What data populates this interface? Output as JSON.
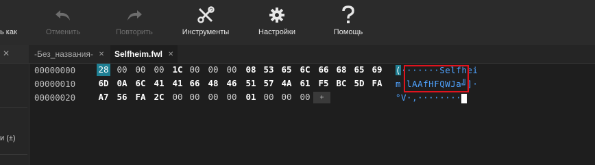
{
  "toolbar": {
    "save_as_partial": "ь как",
    "undo_label": "Отменить",
    "redo_label": "Повторить",
    "tools_label": "Инструменты",
    "settings_label": "Настройки",
    "help_label": "Помощь"
  },
  "tabs": [
    {
      "label": "-Без_названия-",
      "close": "✕"
    },
    {
      "label": "Selfheim.fwl",
      "close": "✕"
    }
  ],
  "sidebar": {
    "label_partial": "и (±)"
  },
  "hex": {
    "offsets": [
      "00000000",
      "00000010",
      "00000020"
    ],
    "rows": [
      [
        "28",
        "00",
        "00",
        "00",
        "1C",
        "00",
        "00",
        "00",
        "08",
        "53",
        "65",
        "6C",
        "66",
        "68",
        "65",
        "69"
      ],
      [
        "6D",
        "0A",
        "6C",
        "41",
        "41",
        "66",
        "48",
        "46",
        "51",
        "57",
        "4A",
        "61",
        "F5",
        "BC",
        "5D",
        "FA"
      ],
      [
        "A7",
        "56",
        "FA",
        "2C",
        "00",
        "00",
        "00",
        "00",
        "01",
        "00",
        "00",
        "00"
      ]
    ],
    "add_button": "+",
    "ascii": {
      "row0_first": "(",
      "row0_rest": "·······Selfhei",
      "row1": "m lAAfHFQWJa╝]·",
      "row2": "°V·,········"
    }
  }
}
